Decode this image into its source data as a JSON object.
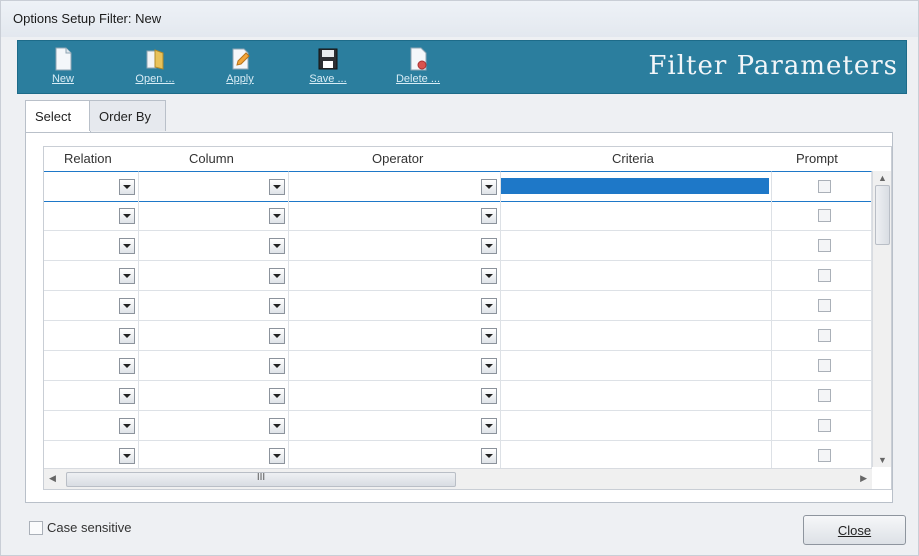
{
  "window": {
    "title": "Options Setup Filter: New"
  },
  "toolbar": {
    "banner": "Filter Parameters",
    "buttons": [
      {
        "label": "New",
        "icon": "new-document-icon"
      },
      {
        "label": "Open ...",
        "icon": "open-folder-icon"
      },
      {
        "label": "Apply",
        "icon": "apply-icon"
      },
      {
        "label": "Save ...",
        "icon": "save-disk-icon"
      },
      {
        "label": "Delete ...",
        "icon": "delete-document-icon"
      }
    ]
  },
  "tabs": [
    {
      "label": "Select",
      "active": true
    },
    {
      "label": "Order By",
      "active": false
    }
  ],
  "grid": {
    "columns": [
      "Relation",
      "Column",
      "Operator",
      "Criteria",
      "Prompt"
    ],
    "row_count": 10,
    "selected_row": 0,
    "hscroll_grip": "III"
  },
  "footer": {
    "case_sensitive_label": "Case sensitive",
    "case_sensitive_checked": false,
    "close_label": "Close"
  },
  "colors": {
    "toolbar": "#2b7e9e",
    "selection": "#1e78c8"
  }
}
